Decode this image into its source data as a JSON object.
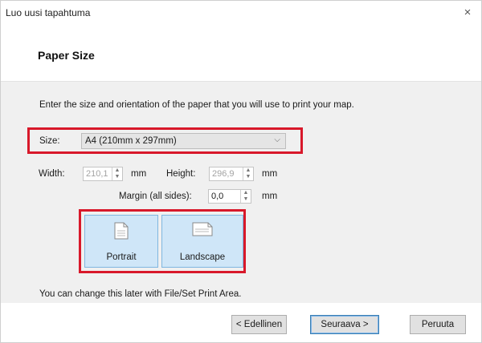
{
  "window": {
    "title": "Luo uusi tapahtuma",
    "close_label": "×"
  },
  "header": {
    "title": "Paper Size"
  },
  "content": {
    "intro": "Enter the size and orientation of the paper that you will use to print your map.",
    "size": {
      "label": "Size:",
      "value": "A4 (210mm x 297mm)",
      "chevron": "⌵"
    },
    "width": {
      "label": "Width:",
      "value": "210,1",
      "unit": "mm"
    },
    "height": {
      "label": "Height:",
      "value": "296,9",
      "unit": "mm"
    },
    "margin": {
      "label": "Margin (all sides):",
      "value": "0,0",
      "unit": "mm"
    },
    "orientation": {
      "portrait_label": "Portrait",
      "landscape_label": "Landscape"
    },
    "hint": "You can change this later with File/Set Print Area."
  },
  "footer": {
    "back_label": "< Edellinen",
    "next_label": "Seuraava >",
    "cancel_label": "Peruuta"
  },
  "colors": {
    "highlight": "#d8182a",
    "selected": "#cfe6f8"
  }
}
